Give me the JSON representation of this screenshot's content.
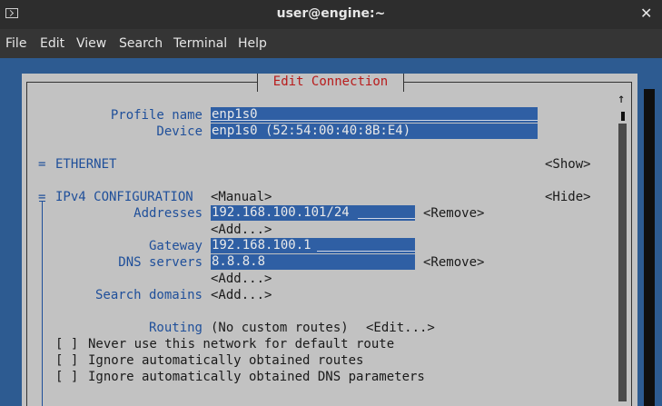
{
  "window": {
    "title": "user@engine:~"
  },
  "menu": {
    "file": "File",
    "edit": "Edit",
    "view": "View",
    "search": "Search",
    "terminal": "Terminal",
    "help": "Help"
  },
  "dialog": {
    "title": "Edit Connection",
    "scroll_up": "↑",
    "profile_name_label": "Profile name",
    "profile_name_value": "enp1s0",
    "device_label": "Device",
    "device_value": "enp1s0 (52:54:00:40:8B:E4)",
    "ethernet_marker": "=",
    "ethernet_label": "ETHERNET",
    "ethernet_toggle": "<Show>",
    "ipv4_marker": "=",
    "ipv4_label": "IPv4 CONFIGURATION",
    "ipv4_method": "<Manual>",
    "ipv4_toggle": "<Hide>",
    "addresses_label": "Addresses",
    "addresses_value": "192.168.100.101/24",
    "addresses_remove": "<Remove>",
    "addresses_add": "<Add...>",
    "gateway_label": "Gateway",
    "gateway_value": "192.168.100.1",
    "dns_label": "DNS servers",
    "dns_value": "8.8.8.8",
    "dns_remove": "<Remove>",
    "dns_add": "<Add...>",
    "search_domains_label": "Search domains",
    "search_domains_add": "<Add...>",
    "routing_label": "Routing",
    "routing_value": "(No custom routes)",
    "routing_edit": "<Edit...>",
    "checkbox_box": "[ ]",
    "check_default_route": "Never use this network for default route",
    "check_ignore_routes": "Ignore automatically obtained routes",
    "check_ignore_dns": "Ignore automatically obtained DNS parameters"
  }
}
